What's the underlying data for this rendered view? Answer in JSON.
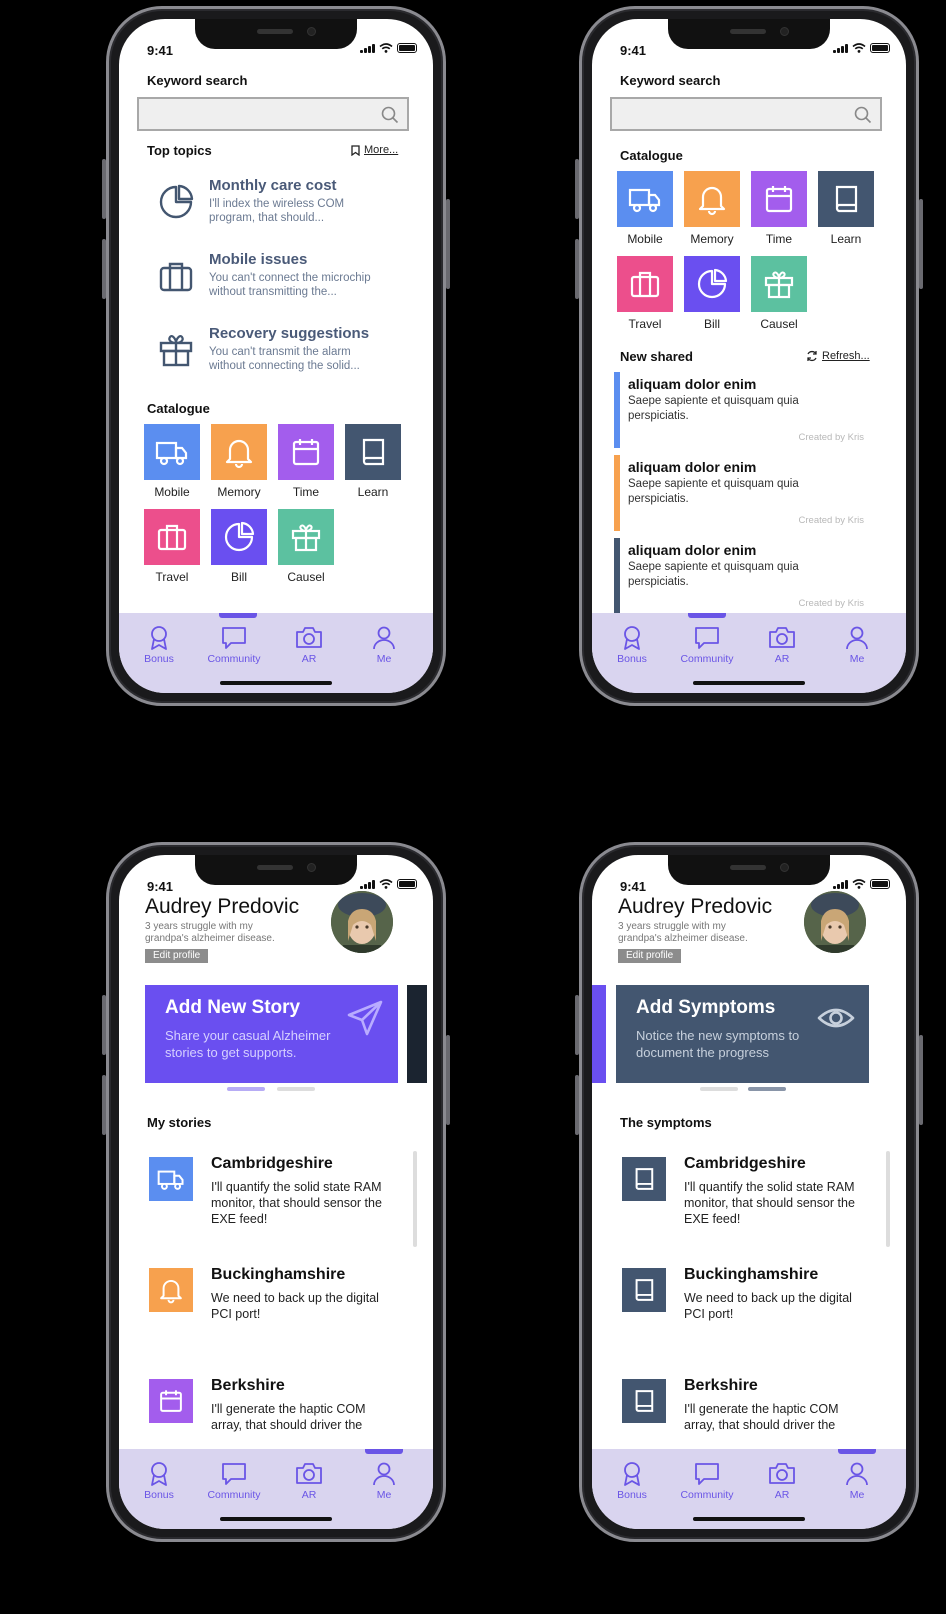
{
  "status": {
    "time": "9:41"
  },
  "search": {
    "title": "Keyword search"
  },
  "top_topics": {
    "title": "Top topics",
    "more": "More...",
    "items": [
      {
        "title": "Monthly care cost",
        "desc": "I'll index the wireless COM program, that should...",
        "icon": "pie-chart-icon"
      },
      {
        "title": "Mobile issues",
        "desc": "You can't connect the microchip without transmitting the...",
        "icon": "briefcase-icon"
      },
      {
        "title": "Recovery suggestions",
        "desc": "You can't transmit the alarm without connecting the solid...",
        "icon": "gift-icon"
      }
    ]
  },
  "catalogue": {
    "title": "Catalogue",
    "items": [
      {
        "label": "Mobile",
        "color": "#5b8ef0",
        "icon": "truck-icon"
      },
      {
        "label": "Memory",
        "color": "#f7a14e",
        "icon": "bell-icon"
      },
      {
        "label": "Time",
        "color": "#a35ded",
        "icon": "calendar-icon"
      },
      {
        "label": "Learn",
        "color": "#435670",
        "icon": "book-icon"
      },
      {
        "label": "Travel",
        "color": "#ec4f8c",
        "icon": "briefcase-icon"
      },
      {
        "label": "Bill",
        "color": "#6a4ff0",
        "icon": "pie-chart-icon"
      },
      {
        "label": "Causel",
        "color": "#5cc1a0",
        "icon": "gift-icon"
      }
    ]
  },
  "new_shared": {
    "title": "New shared",
    "refresh": "Refresh...",
    "items": [
      {
        "title": "aliquam dolor enim",
        "desc": "Saepe sapiente et quisquam quia perspiciatis.",
        "by": "Created by Kris",
        "color": "#5b8ef0"
      },
      {
        "title": "aliquam dolor enim",
        "desc": "Saepe sapiente et quisquam quia perspiciatis.",
        "by": "Created by Kris",
        "color": "#f7a14e"
      },
      {
        "title": "aliquam dolor enim",
        "desc": "Saepe sapiente et quisquam quia perspiciatis.",
        "by": "Created by Kris",
        "color": "#435670"
      }
    ]
  },
  "tabs": [
    {
      "label": "Bonus",
      "icon": "award-icon"
    },
    {
      "label": "Community",
      "icon": "message-icon"
    },
    {
      "label": "AR",
      "icon": "camera-icon"
    },
    {
      "label": "Me",
      "icon": "user-icon"
    }
  ],
  "profile": {
    "name": "Audrey Predovic",
    "desc": "3 years struggle with my grandpa's alzheimer disease.",
    "edit": "Edit profile"
  },
  "banners": {
    "story": {
      "title": "Add New Story",
      "desc": "Share your casual Alzheimer stories to get supports.",
      "color": "#6a4ff0",
      "icon": "send-icon"
    },
    "symptoms": {
      "title": "Add Symptoms",
      "desc": "Notice the new symptoms to document the progress",
      "color": "#435670",
      "icon": "eye-icon"
    }
  },
  "my_stories": {
    "title": "My stories",
    "items": [
      {
        "title": "Cambridgeshire",
        "desc": "I'll quantify the solid state RAM monitor, that should sensor the EXE feed!",
        "color": "#5b8ef0",
        "icon": "truck-icon"
      },
      {
        "title": "Buckinghamshire",
        "desc": "We need to back up the digital PCI port!",
        "color": "#f7a14e",
        "icon": "bell-icon"
      },
      {
        "title": "Berkshire",
        "desc": "I'll generate the haptic COM array, that should driver the",
        "color": "#a35ded",
        "icon": "calendar-icon"
      }
    ]
  },
  "symptoms": {
    "title": "The symptoms",
    "items": [
      {
        "title": "Cambridgeshire",
        "desc": "I'll quantify the solid state RAM monitor, that should sensor the EXE feed!",
        "color": "#435670",
        "icon": "book-icon"
      },
      {
        "title": "Buckinghamshire",
        "desc": "We need to back up the digital PCI port!",
        "color": "#435670",
        "icon": "book-icon"
      },
      {
        "title": "Berkshire",
        "desc": "I'll generate the haptic COM array, that should driver the",
        "color": "#435670",
        "icon": "book-icon"
      }
    ]
  }
}
